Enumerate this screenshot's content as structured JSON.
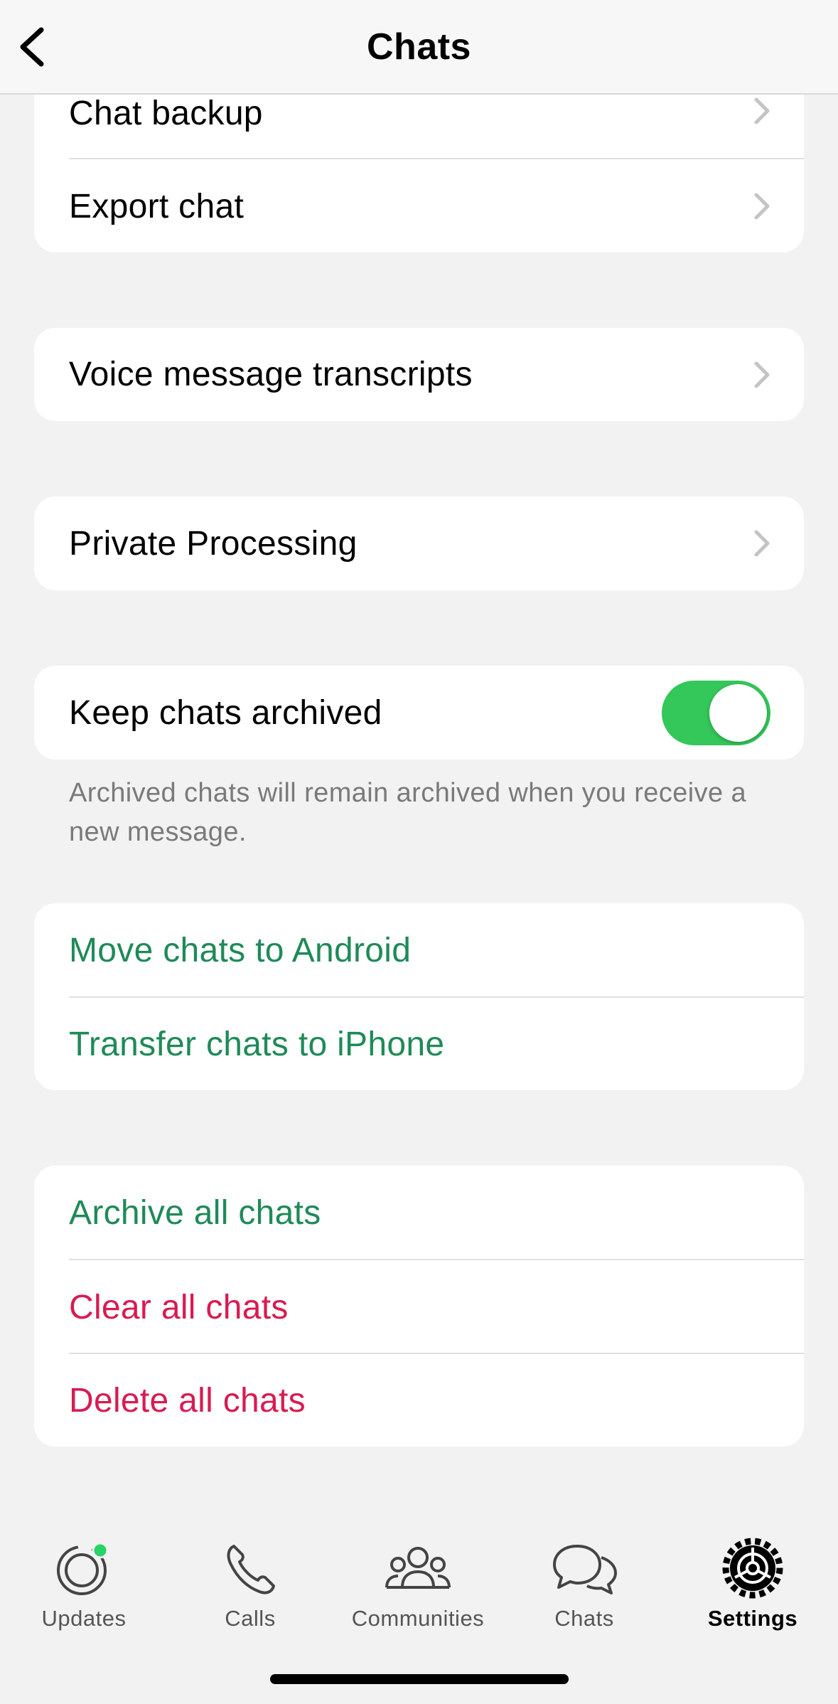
{
  "header": {
    "title": "Chats"
  },
  "group1": {
    "chat_backup": "Chat backup",
    "export_chat": "Export chat"
  },
  "group2": {
    "voice_transcripts": "Voice message transcripts"
  },
  "group3": {
    "private_processing": "Private Processing"
  },
  "group4": {
    "keep_archived": "Keep chats archived",
    "keep_archived_on": true,
    "footnote": "Archived chats will remain archived when you receive a new message."
  },
  "group5": {
    "move_android": "Move chats to Android",
    "transfer_iphone": "Transfer chats to iPhone"
  },
  "group6": {
    "archive_all": "Archive all chats",
    "clear_all": "Clear all chats",
    "delete_all": "Delete all chats"
  },
  "tabbar": {
    "tabs": [
      {
        "label": "Updates",
        "icon": "updates-icon",
        "badge": true
      },
      {
        "label": "Calls",
        "icon": "phone-icon"
      },
      {
        "label": "Communities",
        "icon": "communities-icon"
      },
      {
        "label": "Chats",
        "icon": "chats-icon"
      },
      {
        "label": "Settings",
        "icon": "gear-icon",
        "active": true
      }
    ]
  },
  "colors": {
    "accent_green": "#1f8a58",
    "destructive_red": "#d81b52",
    "toggle_green": "#34c759",
    "badge_green": "#25d366"
  }
}
